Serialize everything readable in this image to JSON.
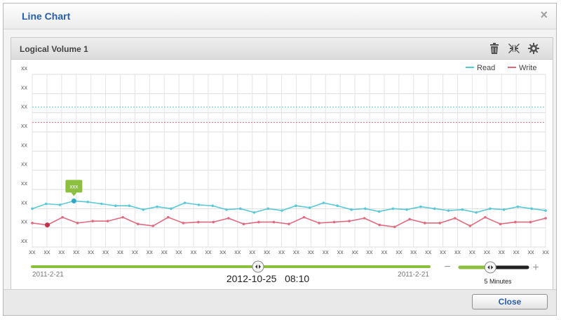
{
  "window": {
    "title": "Line Chart",
    "close_symbol": "×"
  },
  "panel": {
    "title": "Logical Volume 1",
    "tools": [
      "trash-icon",
      "collapse-icon",
      "gear-icon"
    ]
  },
  "chart_data": {
    "type": "line",
    "y_tick_labels": [
      "xx",
      "xx",
      "xx",
      "xx",
      "xx",
      "xx",
      "xx",
      "xx",
      "xx",
      "xx"
    ],
    "x_tick_labels": [
      "xx",
      "xx",
      "xx",
      "xx",
      "xx",
      "xx",
      "xx",
      "xx",
      "xx",
      "xx",
      "xx",
      "xx",
      "xx",
      "xx",
      "xx",
      "xx",
      "xx",
      "xx",
      "xx",
      "xx",
      "xx",
      "xx",
      "xx",
      "xx",
      "xx",
      "xx",
      "xx",
      "xx",
      "xx",
      "xx",
      "xx",
      "xx",
      "xx",
      "xx",
      "xx",
      "xx"
    ],
    "ylim": [
      0,
      9
    ],
    "grid": true,
    "legend_position": "top-right",
    "series": [
      {
        "name": "Read",
        "color": "#5bc8d6",
        "values": [
          2.0,
          2.25,
          2.2,
          2.4,
          2.35,
          2.25,
          2.15,
          2.15,
          1.95,
          2.1,
          2.0,
          2.3,
          2.2,
          2.15,
          1.95,
          2.0,
          1.8,
          2.0,
          1.9,
          2.15,
          2.05,
          2.3,
          2.15,
          1.95,
          2.0,
          1.85,
          2.0,
          1.95,
          2.1,
          2.0,
          1.9,
          1.95,
          1.8,
          2.0,
          1.95,
          2.1,
          2.0,
          1.9
        ]
      },
      {
        "name": "Write",
        "color": "#e06b80",
        "values": [
          1.25,
          1.15,
          1.55,
          1.25,
          1.35,
          1.35,
          1.55,
          1.2,
          1.1,
          1.55,
          1.25,
          1.3,
          1.3,
          1.5,
          1.2,
          1.3,
          1.3,
          1.2,
          1.55,
          1.25,
          1.3,
          1.35,
          1.5,
          1.15,
          1.05,
          1.45,
          1.25,
          1.25,
          1.5,
          1.1,
          1.55,
          1.2,
          1.3,
          1.3,
          1.5
        ]
      }
    ],
    "threshold_lines": [
      {
        "series": "Read",
        "value": 7.3,
        "color": "#5bc8d6"
      },
      {
        "series": "Write",
        "value": 6.5,
        "color": "#e06b80"
      }
    ],
    "highlight": {
      "series": "Read",
      "index": 3,
      "label": "xxx",
      "label_color": "#8cbf3f"
    },
    "highlight_write": {
      "series": "Write",
      "index": 1
    }
  },
  "time_slider": {
    "start_label": "2011-2-21",
    "end_label": "2011-2-21",
    "current": "2012-10-25   08:10",
    "position": 0.985
  },
  "zoom_slider": {
    "minus": "−",
    "plus": "+",
    "label": "5 Minutes",
    "position": 0.45
  },
  "footer": {
    "close_label": "Close"
  }
}
